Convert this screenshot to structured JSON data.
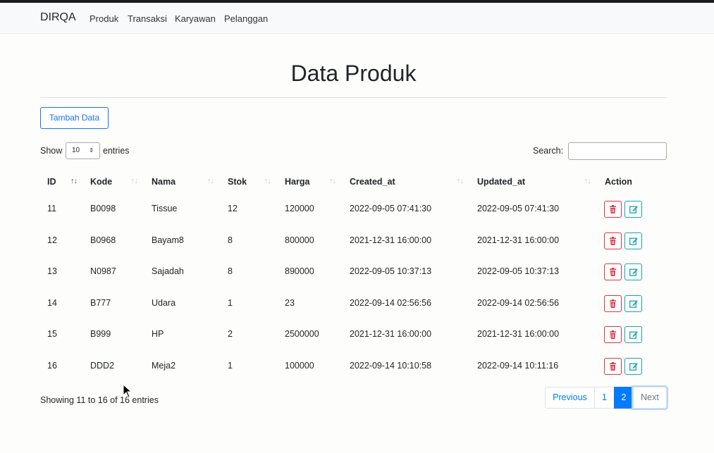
{
  "navbar": {
    "brand": "DIRQA",
    "links": [
      "Produk",
      "Transaksi",
      "Karyawan",
      "Pelanggan"
    ]
  },
  "page": {
    "title": "Data Produk"
  },
  "toolbar": {
    "add_label": "Tambah Data"
  },
  "length": {
    "show_label": "Show",
    "value": "10",
    "entries_label": "entries"
  },
  "search": {
    "label": "Search:",
    "value": ""
  },
  "table": {
    "columns": [
      "ID",
      "Kode",
      "Nama",
      "Stok",
      "Harga",
      "Created_at",
      "Updated_at",
      "Action"
    ],
    "sorted_column": "ID",
    "rows": [
      [
        "11",
        "B0098",
        "Tissue",
        "12",
        "120000",
        "2022-09-05 07:41:30",
        "2022-09-05 07:41:30"
      ],
      [
        "12",
        "B0968",
        "Bayam8",
        "8",
        "800000",
        "2021-12-31 16:00:00",
        "2021-12-31 16:00:00"
      ],
      [
        "13",
        "N0987",
        "Sajadah",
        "8",
        "890000",
        "2022-09-05 10:37:13",
        "2022-09-05 10:37:13"
      ],
      [
        "14",
        "B777",
        "Udara",
        "1",
        "23",
        "2022-09-14 02:56:56",
        "2022-09-14 02:56:56"
      ],
      [
        "15",
        "B999",
        "HP",
        "2",
        "2500000",
        "2021-12-31 16:00:00",
        "2021-12-31 16:00:00"
      ],
      [
        "16",
        "DDD2",
        "Meja2",
        "1",
        "100000",
        "2022-09-14 10:10:58",
        "2022-09-14 10:11:16"
      ]
    ],
    "row_actions": {
      "delete_icon": "trash-icon",
      "edit_icon": "edit-icon"
    }
  },
  "footer": {
    "info": "Showing 11 to 16 of 16 entries",
    "pagination": {
      "previous": "Previous",
      "pages": [
        "1",
        "2"
      ],
      "current": "2",
      "next": "Next"
    }
  },
  "colors": {
    "primary": "#007bff",
    "danger": "#dc3545",
    "info": "#17a2b8"
  }
}
